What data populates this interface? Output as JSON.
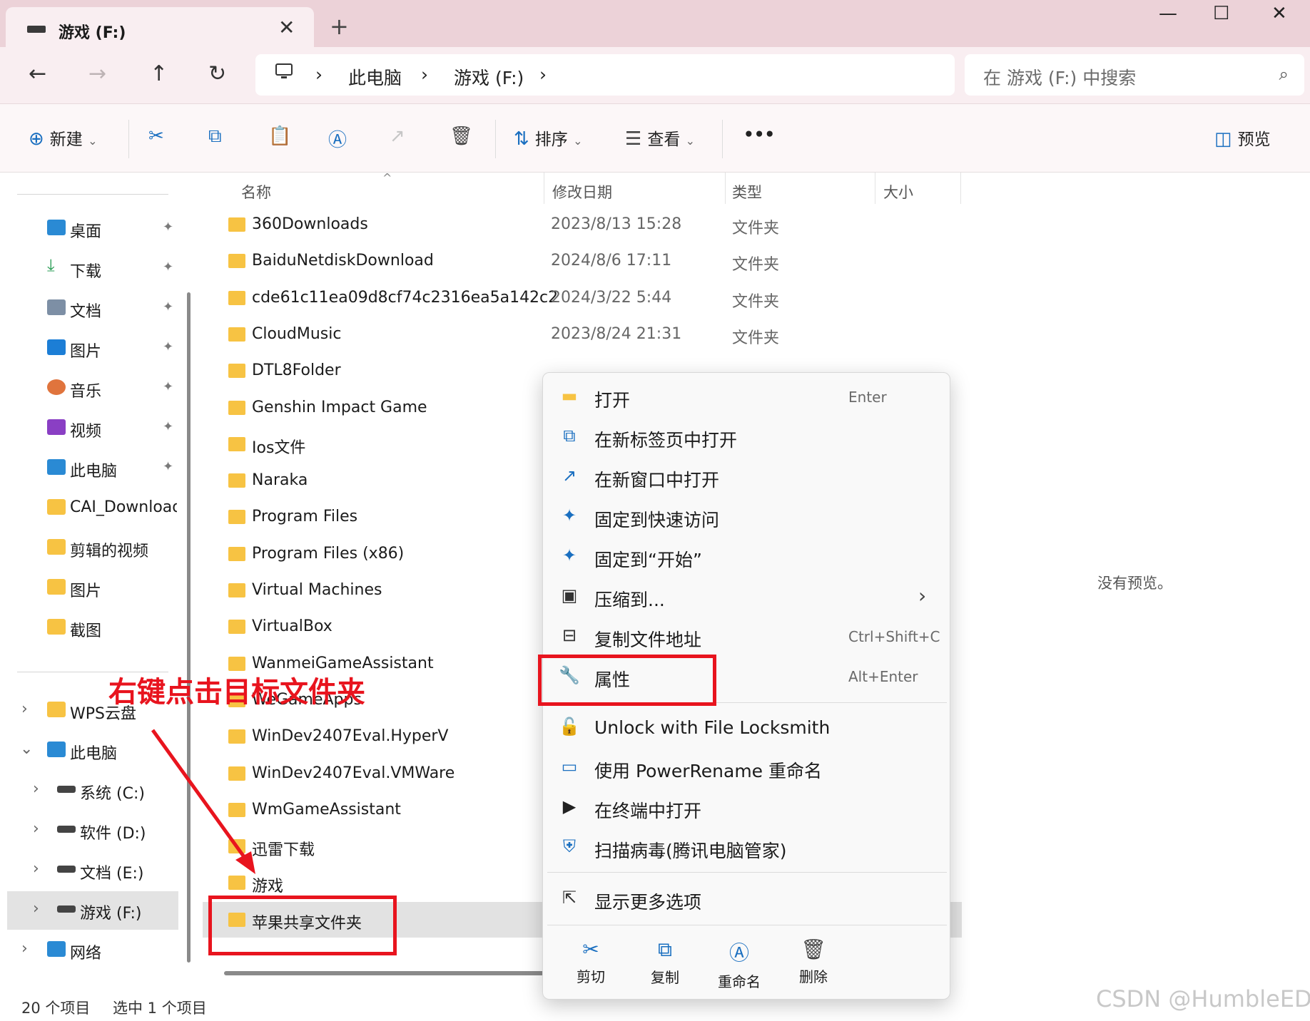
{
  "window": {
    "tab_title": "游戏 (F:)",
    "tab_close": "✕",
    "new_tab": "+",
    "minimize": "—",
    "maximize": "☐",
    "close": "✕"
  },
  "nav": {
    "back": "←",
    "forward": "→",
    "up": "↑",
    "refresh": "↻"
  },
  "address": {
    "pc_icon": "computer-icon",
    "sep": "›",
    "crumb1": "此电脑",
    "crumb2": "游戏 (F:)"
  },
  "search": {
    "placeholder": "在 游戏 (F:) 中搜索",
    "icon": "⌕"
  },
  "toolbar": {
    "new_label": "新建",
    "sort_label": "排序",
    "view_label": "查看",
    "more": "•••",
    "preview_label": "预览",
    "dropdown": "⌄"
  },
  "sidebar": {
    "quick": [
      {
        "label": "桌面",
        "color": "#2a8ad4"
      },
      {
        "label": "下载",
        "color": "#2a9d55"
      },
      {
        "label": "文档",
        "color": "#7d8fa5"
      },
      {
        "label": "图片",
        "color": "#1c7ed6"
      },
      {
        "label": "音乐",
        "color": "#e0743d"
      },
      {
        "label": "视频",
        "color": "#8a3fc4"
      },
      {
        "label": "此电脑",
        "color": "#2a8ad4"
      }
    ],
    "folders": [
      {
        "label": "CAI_Downloads"
      },
      {
        "label": "剪辑的视频"
      },
      {
        "label": "图片"
      },
      {
        "label": "截图"
      }
    ],
    "tree": {
      "wps": "WPS云盘",
      "thispc": "此电脑",
      "c": "系统 (C:)",
      "d": "软件 (D:)",
      "e": "文档 (E:)",
      "f": "游戏 (F:)",
      "network": "网络"
    },
    "chev_right": "›",
    "chev_down": "⌄",
    "pin": "📌"
  },
  "columns": {
    "name": "名称",
    "date": "修改日期",
    "type": "类型",
    "size": "大小",
    "sort_caret": "^"
  },
  "files": [
    {
      "name": "360Downloads",
      "date": "2023/8/13 15:28",
      "type": "文件夹"
    },
    {
      "name": "BaiduNetdiskDownload",
      "date": "2024/8/6 17:11",
      "type": "文件夹"
    },
    {
      "name": "cde61c11ea09d8cf74c2316ea5a142c2",
      "date": "2024/3/22 5:44",
      "type": "文件夹"
    },
    {
      "name": "CloudMusic",
      "date": "2023/8/24 21:31",
      "type": "文件夹"
    },
    {
      "name": "DTL8Folder",
      "date": "",
      "type": ""
    },
    {
      "name": "Genshin Impact Game",
      "date": "",
      "type": ""
    },
    {
      "name": "Ios文件",
      "date": "",
      "type": ""
    },
    {
      "name": "Naraka",
      "date": "",
      "type": ""
    },
    {
      "name": "Program Files",
      "date": "",
      "type": ""
    },
    {
      "name": "Program Files (x86)",
      "date": "",
      "type": ""
    },
    {
      "name": "Virtual Machines",
      "date": "",
      "type": ""
    },
    {
      "name": "VirtualBox",
      "date": "",
      "type": ""
    },
    {
      "name": "WanmeiGameAssistant",
      "date": "",
      "type": ""
    },
    {
      "name": "WeGameApps",
      "date": "",
      "type": ""
    },
    {
      "name": "WinDev2407Eval.HyperV",
      "date": "",
      "type": ""
    },
    {
      "name": "WinDev2407Eval.VMWare",
      "date": "",
      "type": ""
    },
    {
      "name": "WmGameAssistant",
      "date": "",
      "type": ""
    },
    {
      "name": "迅雷下载",
      "date": "",
      "type": ""
    },
    {
      "name": "游戏",
      "date": "",
      "type": ""
    },
    {
      "name": "苹果共享文件夹",
      "date": "",
      "type": ""
    }
  ],
  "preview": {
    "text": "没有预览。"
  },
  "status": {
    "count": "20 个项目",
    "selected": "选中 1 个项目"
  },
  "context_menu": {
    "open": "打开",
    "open_key": "Enter",
    "open_new_tab": "在新标签页中打开",
    "open_new_window": "在新窗口中打开",
    "pin_quick": "固定到快速访问",
    "pin_start": "固定到“开始”",
    "compress": "压缩到...",
    "compress_arrow": "›",
    "copy_path": "复制文件地址",
    "copy_path_key": "Ctrl+Shift+C",
    "properties": "属性",
    "properties_key": "Alt+Enter",
    "unlock": "Unlock with File Locksmith",
    "powerrename": "使用 PowerRename 重命名",
    "terminal": "在终端中打开",
    "scan": "扫描病毒(腾讯电脑管家)",
    "more_options": "显示更多选项",
    "quick_actions": {
      "cut": "剪切",
      "copy": "复制",
      "rename": "重命名",
      "delete": "删除"
    }
  },
  "annotation": {
    "text": "右键点击目标文件夹"
  },
  "watermark": "CSDN @HumbleED",
  "colors": {
    "accent": "#1a6fc0",
    "folder": "#f7c343",
    "annotation_red": "#e8141e",
    "titlebar": "#ecd2d8"
  }
}
